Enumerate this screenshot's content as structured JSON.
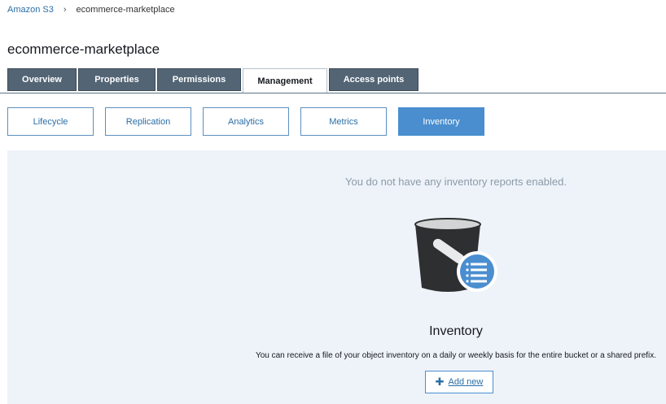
{
  "breadcrumb": {
    "root": "Amazon S3",
    "separator": "›",
    "current": "ecommerce-marketplace"
  },
  "page_title": "ecommerce-marketplace",
  "tabs": [
    {
      "label": "Overview",
      "active": false
    },
    {
      "label": "Properties",
      "active": false
    },
    {
      "label": "Permissions",
      "active": false
    },
    {
      "label": "Management",
      "active": true
    },
    {
      "label": "Access points",
      "active": false
    }
  ],
  "subtabs": [
    {
      "label": "Lifecycle",
      "active": false
    },
    {
      "label": "Replication",
      "active": false
    },
    {
      "label": "Analytics",
      "active": false
    },
    {
      "label": "Metrics",
      "active": false
    },
    {
      "label": "Inventory",
      "active": true
    }
  ],
  "empty_state": {
    "message": "You do not have any inventory reports enabled.",
    "icon": "bucket-inventory-icon",
    "title": "Inventory",
    "description": "You can receive a file of your object inventory on a daily or weekly basis for the entire bucket or a shared prefix.",
    "add_button": {
      "icon": "plus-icon",
      "label": "Add new"
    }
  },
  "colors": {
    "tab_bg": "#536575",
    "accent": "#4a8ed0",
    "panel_bg": "#eef3f9",
    "link": "#2a6ea6"
  }
}
